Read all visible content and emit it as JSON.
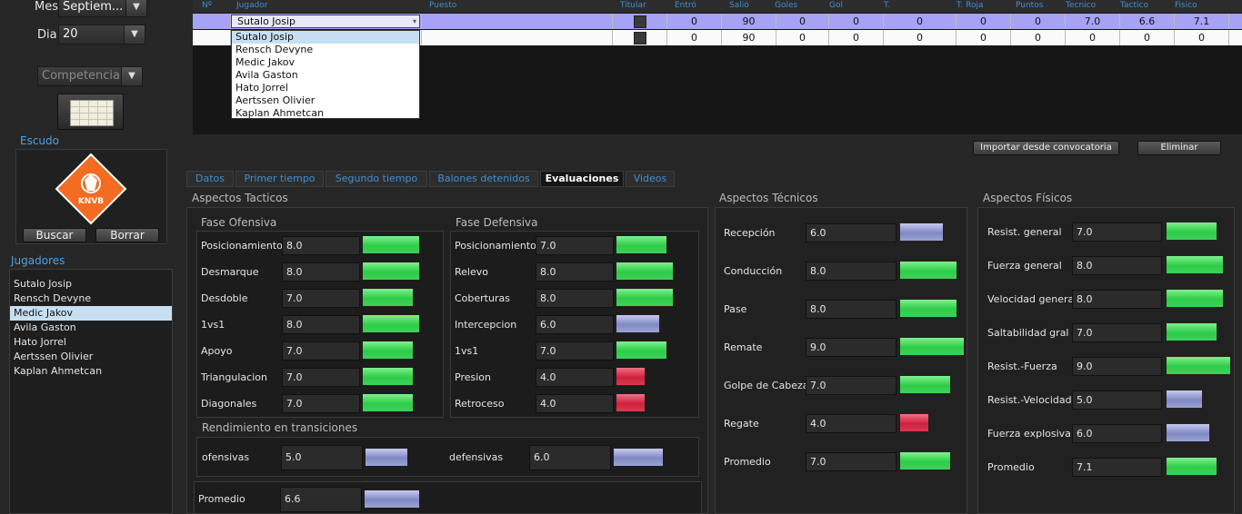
{
  "left": {
    "mes_label": "Mes",
    "mes_value": "Septiem...",
    "dia_label": "Dia",
    "dia_value": "20",
    "competencia": "Competencia",
    "escudo_title": "Escudo",
    "logo_text": "KNVB",
    "buscar": "Buscar",
    "borrar": "Borrar",
    "jugadores_title": "Jugadores",
    "jugadores": [
      "Sutalo Josip",
      "Rensch Devyne",
      "Medic Jakov",
      "Avila Gaston",
      "Hato Jorrel",
      "Aertssen Olivier",
      "Kaplan Ahmetcan"
    ],
    "selected_index": 2
  },
  "grid": {
    "headers": [
      "Nº",
      "Jugador",
      "Puesto",
      "Titular",
      "Entró",
      "Salió",
      "Goles",
      "Gol",
      "T.",
      "T. Roja",
      "Puntos",
      "Tecnico",
      "Tactico",
      "Fisico"
    ],
    "rows": [
      {
        "jugador": "Sutalo Josip",
        "entro": "0",
        "salio": "90",
        "goles": "0",
        "gol": "0",
        "t_amarilla": "0",
        "t_roja": "0",
        "puntos": "0",
        "tecnico": "7.0",
        "tactico": "6.6",
        "fisico": "7.1"
      },
      {
        "jugador": "",
        "entro": "0",
        "salio": "90",
        "goles": "0",
        "gol": "0",
        "t_amarilla": "0",
        "t_roja": "0",
        "puntos": "0",
        "tecnico": "0",
        "tactico": "0",
        "fisico": "0"
      }
    ],
    "dropdown_options": [
      "Sutalo Josip",
      "Rensch Devyne",
      "Medic Jakov",
      "Avila Gaston",
      "Hato Jorrel",
      "Aertssen Olivier",
      "Kaplan Ahmetcan"
    ],
    "importar": "Importar desde convocatoria",
    "eliminar": "Eliminar"
  },
  "tabs": [
    "Datos",
    "Primer tiempo",
    "Segundo tiempo",
    "Balones detenidos",
    "Evaluaciones",
    "Videos"
  ],
  "active_tab": "Evaluaciones",
  "tacticos": {
    "title": "Aspectos Tacticos",
    "ofensiva_title": "Fase Ofensiva",
    "ofensiva": [
      {
        "label": "Posicionamiento",
        "value": "8.0",
        "color": "g"
      },
      {
        "label": "Desmarque",
        "value": "8.0",
        "color": "g"
      },
      {
        "label": "Desdoble",
        "value": "7.0",
        "color": "g"
      },
      {
        "label": "1vs1",
        "value": "8.0",
        "color": "g"
      },
      {
        "label": "Apoyo",
        "value": "7.0",
        "color": "g"
      },
      {
        "label": "Triangulacion",
        "value": "7.0",
        "color": "g"
      },
      {
        "label": "Diagonales",
        "value": "7.0",
        "color": "g"
      }
    ],
    "defensiva_title": "Fase Defensiva",
    "defensiva": [
      {
        "label": "Posicionamiento",
        "value": "7.0",
        "color": "g"
      },
      {
        "label": "Relevo",
        "value": "8.0",
        "color": "g"
      },
      {
        "label": "Coberturas",
        "value": "8.0",
        "color": "g"
      },
      {
        "label": "Intercepcion",
        "value": "6.0",
        "color": "b"
      },
      {
        "label": "1vs1",
        "value": "7.0",
        "color": "g"
      },
      {
        "label": "Presion",
        "value": "4.0",
        "color": "r"
      },
      {
        "label": "Retroceso",
        "value": "4.0",
        "color": "r"
      }
    ],
    "transiciones_title": "Rendimiento en transiciones",
    "ofensivas_label": "ofensivas",
    "ofensivas_value": "5.0",
    "defensivas_label": "defensivas",
    "defensivas_value": "6.0",
    "promedio_label": "Promedio",
    "promedio_value": "6.6"
  },
  "tecnicos": {
    "title": "Aspectos Técnicos",
    "items": [
      {
        "label": "Recepción",
        "value": "6.0",
        "color": "b"
      },
      {
        "label": "Conducción",
        "value": "8.0",
        "color": "g"
      },
      {
        "label": "Pase",
        "value": "8.0",
        "color": "g"
      },
      {
        "label": "Remate",
        "value": "9.0",
        "color": "g"
      },
      {
        "label": "Golpe de Cabeza",
        "value": "7.0",
        "color": "g"
      },
      {
        "label": "Regate",
        "value": "4.0",
        "color": "r"
      },
      {
        "label": "Promedio",
        "value": "7.0",
        "color": "g"
      }
    ]
  },
  "fisicos": {
    "title": "Aspectos Físicos",
    "items": [
      {
        "label": "Resist. general",
        "value": "7.0",
        "color": "g"
      },
      {
        "label": "Fuerza general",
        "value": "8.0",
        "color": "g"
      },
      {
        "label": "Velocidad general",
        "value": "8.0",
        "color": "g"
      },
      {
        "label": "Saltabilidad gral",
        "value": "7.0",
        "color": "g"
      },
      {
        "label": "Resist.-Fuerza",
        "value": "9.0",
        "color": "g"
      },
      {
        "label": "Resist.-Velocidad",
        "value": "5.0",
        "color": "b"
      },
      {
        "label": "Fuerza explosiva",
        "value": "6.0",
        "color": "b"
      },
      {
        "label": "Promedio",
        "value": "7.1",
        "color": "g"
      }
    ]
  }
}
